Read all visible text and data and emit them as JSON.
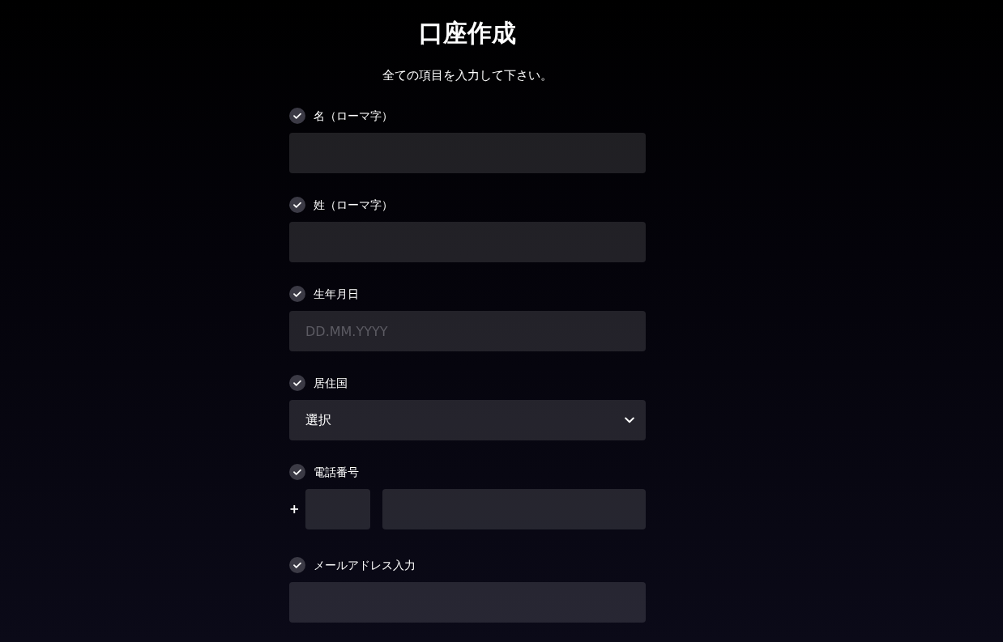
{
  "title": "口座作成",
  "subtitle": "全ての項目を入力して下さい。",
  "fields": [
    {
      "kind": "text",
      "label": "名（ローマ字）"
    },
    {
      "kind": "text",
      "label": "姓（ローマ字）"
    },
    {
      "kind": "date",
      "label": "生年月日",
      "placeholder": "DD.MM.YYYY"
    },
    {
      "kind": "select",
      "label": "居住国",
      "value": "選択"
    },
    {
      "kind": "phone",
      "label": "電話番号",
      "prefix": "+"
    },
    {
      "kind": "email",
      "label": "メールアドレス入力"
    }
  ]
}
